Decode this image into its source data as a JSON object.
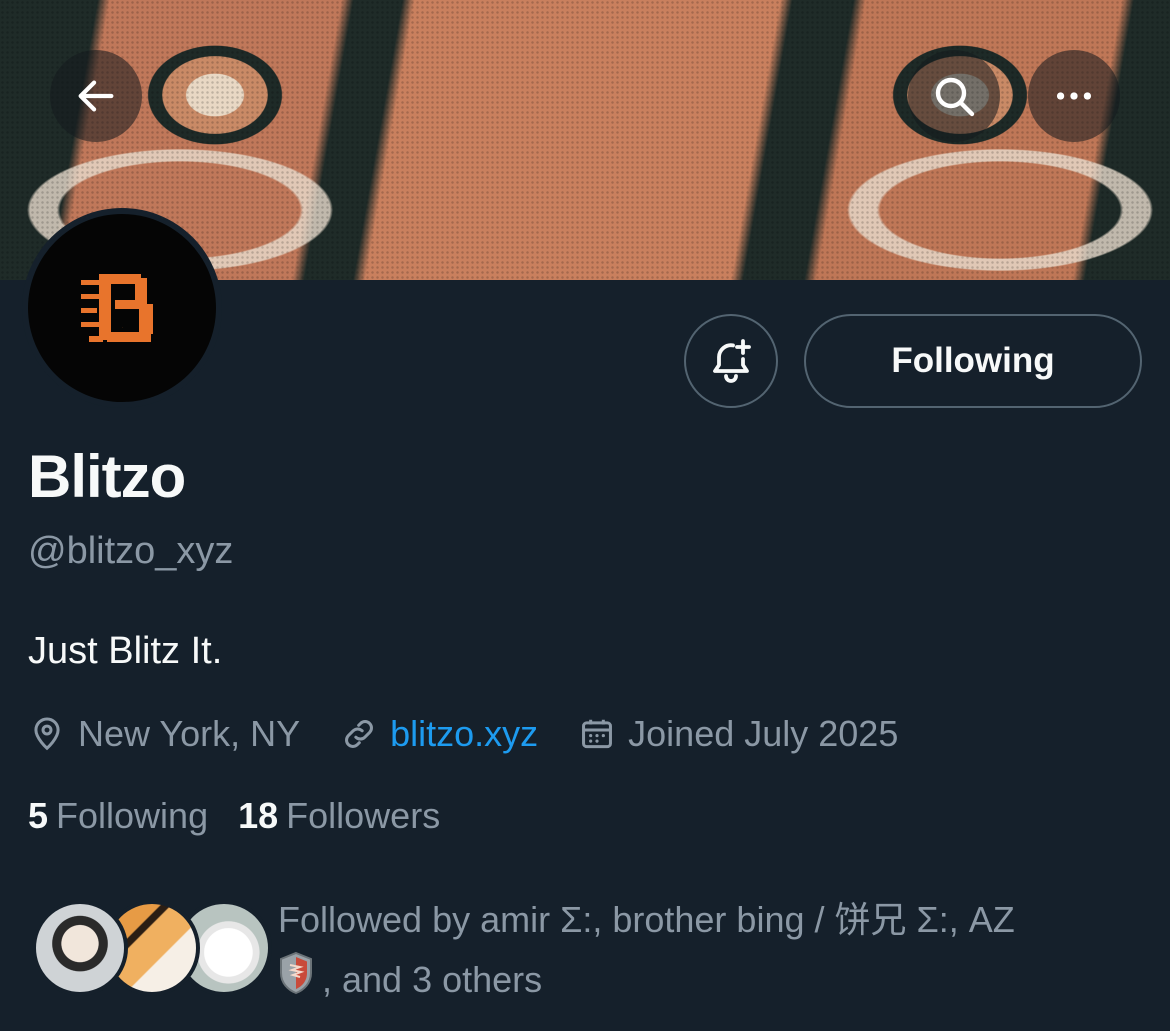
{
  "banner": {
    "description_icon": "tiger-eyes-banner"
  },
  "nav": {
    "back_icon": "arrow-left-icon",
    "search_icon": "search-icon",
    "more_icon": "more-horizontal-icon"
  },
  "profile": {
    "avatar_icon": "blackletter-b-logo",
    "avatar_letter": "B",
    "display_name": "Blitzo",
    "handle": "@blitzo_xyz",
    "bio": "Just Blitz It.",
    "location": "New York, NY",
    "website": "blitzo.xyz",
    "joined": "Joined July 2025"
  },
  "actions": {
    "notify_icon": "bell-plus-icon",
    "follow_label": "Following"
  },
  "stats": {
    "following_count": "5",
    "following_label": "Following",
    "followers_count": "18",
    "followers_label": "Followers"
  },
  "followed_by": {
    "prefix": "Followed by amir Σ:, brother bing / 饼兄 Σ:, AZ",
    "suffix": ", and 3 others",
    "badge_icon": "shield-emoji-icon"
  },
  "colors": {
    "background": "#15202b",
    "text_primary": "#f7f9f9",
    "text_secondary": "#8b98a5",
    "link": "#1d9bf0",
    "border": "#536471",
    "brand_orange": "#e8742c"
  }
}
